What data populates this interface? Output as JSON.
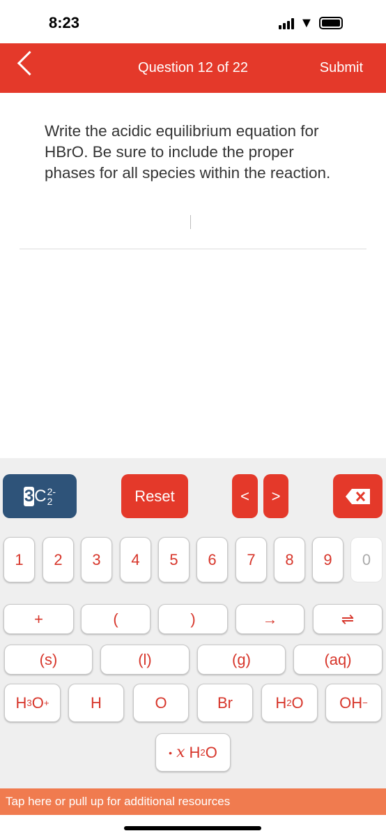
{
  "status_bar": {
    "time": "8:23",
    "icons": [
      "signal-icon",
      "wifi-icon",
      "battery-icon"
    ]
  },
  "header": {
    "title": "Question 12 of 22",
    "submit_label": "Submit",
    "back_icon": "chevron-left-icon",
    "color": "#e4392a"
  },
  "question": {
    "text": "Write the acidic equilibrium equation for HBrO. Be sure to include the proper phases for all species within the reaction."
  },
  "keypad": {
    "mode_button": {
      "digit": "3",
      "base": "C",
      "sub": "2",
      "sup": "2-"
    },
    "reset_label": "Reset",
    "nav": [
      "<",
      ">"
    ],
    "delete_icon": "backspace-icon",
    "numbers": [
      "1",
      "2",
      "3",
      "4",
      "5",
      "6",
      "7",
      "8",
      "9",
      "0"
    ],
    "operators": [
      "+",
      "(",
      ")",
      "→",
      "⇌"
    ],
    "phases": [
      "(s)",
      "(l)",
      "(g)",
      "(aq)"
    ],
    "species": {
      "h3o": {
        "a": "H",
        "sub": "3",
        "b": "O",
        "sup": "+"
      },
      "h": "H",
      "o": "O",
      "br": "Br",
      "h2o": {
        "a": "H",
        "sub": "2",
        "b": "O"
      },
      "oh": {
        "a": "OH",
        "sup": "−"
      }
    },
    "hydrate": {
      "dot": "•",
      "x": "x",
      "a": "H",
      "sub": "2",
      "b": "O"
    }
  },
  "resources_bar": {
    "text": "Tap here or pull up for additional resources",
    "color": "#f07b4f"
  }
}
